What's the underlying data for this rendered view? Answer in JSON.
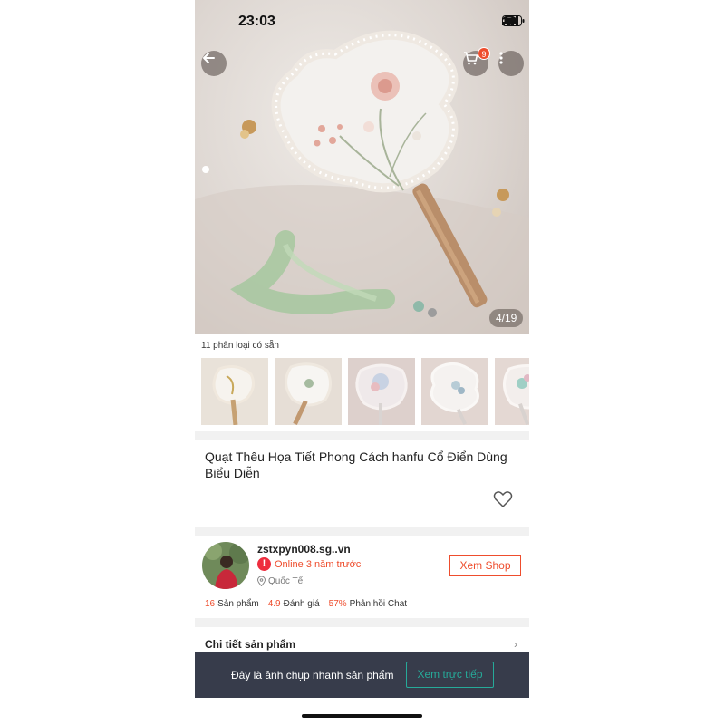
{
  "status_bar": {
    "time": "23:03"
  },
  "header": {
    "cart_count": "9"
  },
  "gallery": {
    "counter": "4/19"
  },
  "variants": {
    "label": "11 phân loại có sẵn"
  },
  "product": {
    "title": "Quạt Thêu Họa Tiết Phong Cách hanfu Cổ Điển Dùng Biểu Diễn"
  },
  "shop": {
    "name": "zstxpyn008.sg..vn",
    "online_icon": "!",
    "online_status": "Online 3 năm trước",
    "location": "Quốc Tế",
    "view_shop_label": "Xem Shop",
    "stats": [
      {
        "value": "16",
        "label": "Sản phẩm"
      },
      {
        "value": "4.9",
        "label": "Đánh giá"
      },
      {
        "value": "57%",
        "label": "Phản hồi Chat"
      }
    ]
  },
  "details": {
    "label": "Chi tiết sản phẩm",
    "chevron": "›"
  },
  "snapshot": {
    "text": "Đây là ảnh chụp nhanh sản phẩm",
    "live_view_label": "Xem trực tiếp"
  },
  "colors": {
    "accent": "#ee4d2d",
    "teal": "#26aa99",
    "banner": "#373c4b"
  },
  "icons": [
    "back-arrow-icon",
    "cart-icon",
    "more-icon",
    "heart-icon",
    "location-pin-icon",
    "chevron-right-icon",
    "signal-icon",
    "wifi-icon",
    "battery-icon"
  ]
}
